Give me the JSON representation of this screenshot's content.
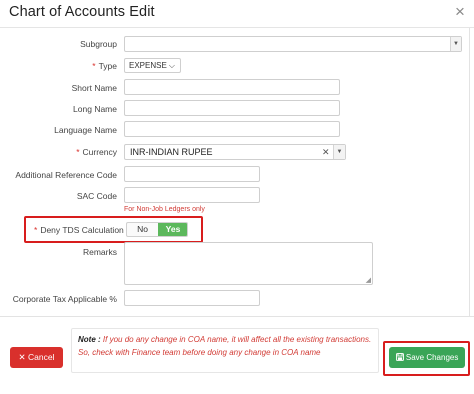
{
  "dialog": {
    "title": "Chart of Accounts Edit",
    "close_symbol": "×"
  },
  "form": {
    "subgroup": {
      "label": "Subgroup",
      "value": ""
    },
    "type": {
      "required_mark": "*",
      "label": "Type",
      "value": "EXPENSE"
    },
    "short_name": {
      "label": "Short Name",
      "value": ""
    },
    "long_name": {
      "label": "Long Name",
      "value": ""
    },
    "language_name": {
      "label": "Language Name",
      "value": ""
    },
    "currency": {
      "required_mark": "*",
      "label": "Currency",
      "value": "INR-INDIAN RUPEE"
    },
    "additional_reference_code": {
      "label": "Additional Reference Code",
      "value": ""
    },
    "sac_code": {
      "label": "SAC Code",
      "value": "",
      "hint": "For Non-Job Ledgers only"
    },
    "deny_tds": {
      "required_mark": "*",
      "label": "Deny TDS Calculation",
      "options": [
        "No",
        "Yes"
      ],
      "selected": "Yes"
    },
    "remarks": {
      "label": "Remarks",
      "value": ""
    },
    "corporate_tax": {
      "label": "Corporate Tax Applicable %",
      "value": ""
    }
  },
  "footer": {
    "cancel_label": "Cancel",
    "save_label": "Save Changes",
    "note_title": "Note :",
    "note_text": "If you do any change in COA name, it will affect all the existing transactions. So, check with Finance team before doing any change in COA name"
  },
  "colors": {
    "required": "#d9302c",
    "accent_green": "#3aa557",
    "highlight_red": "#d81d1d",
    "note_red": "#d23b35"
  },
  "icons": {
    "cancel": "close-icon",
    "save": "save-icon",
    "select": "chevron-down-icon"
  }
}
